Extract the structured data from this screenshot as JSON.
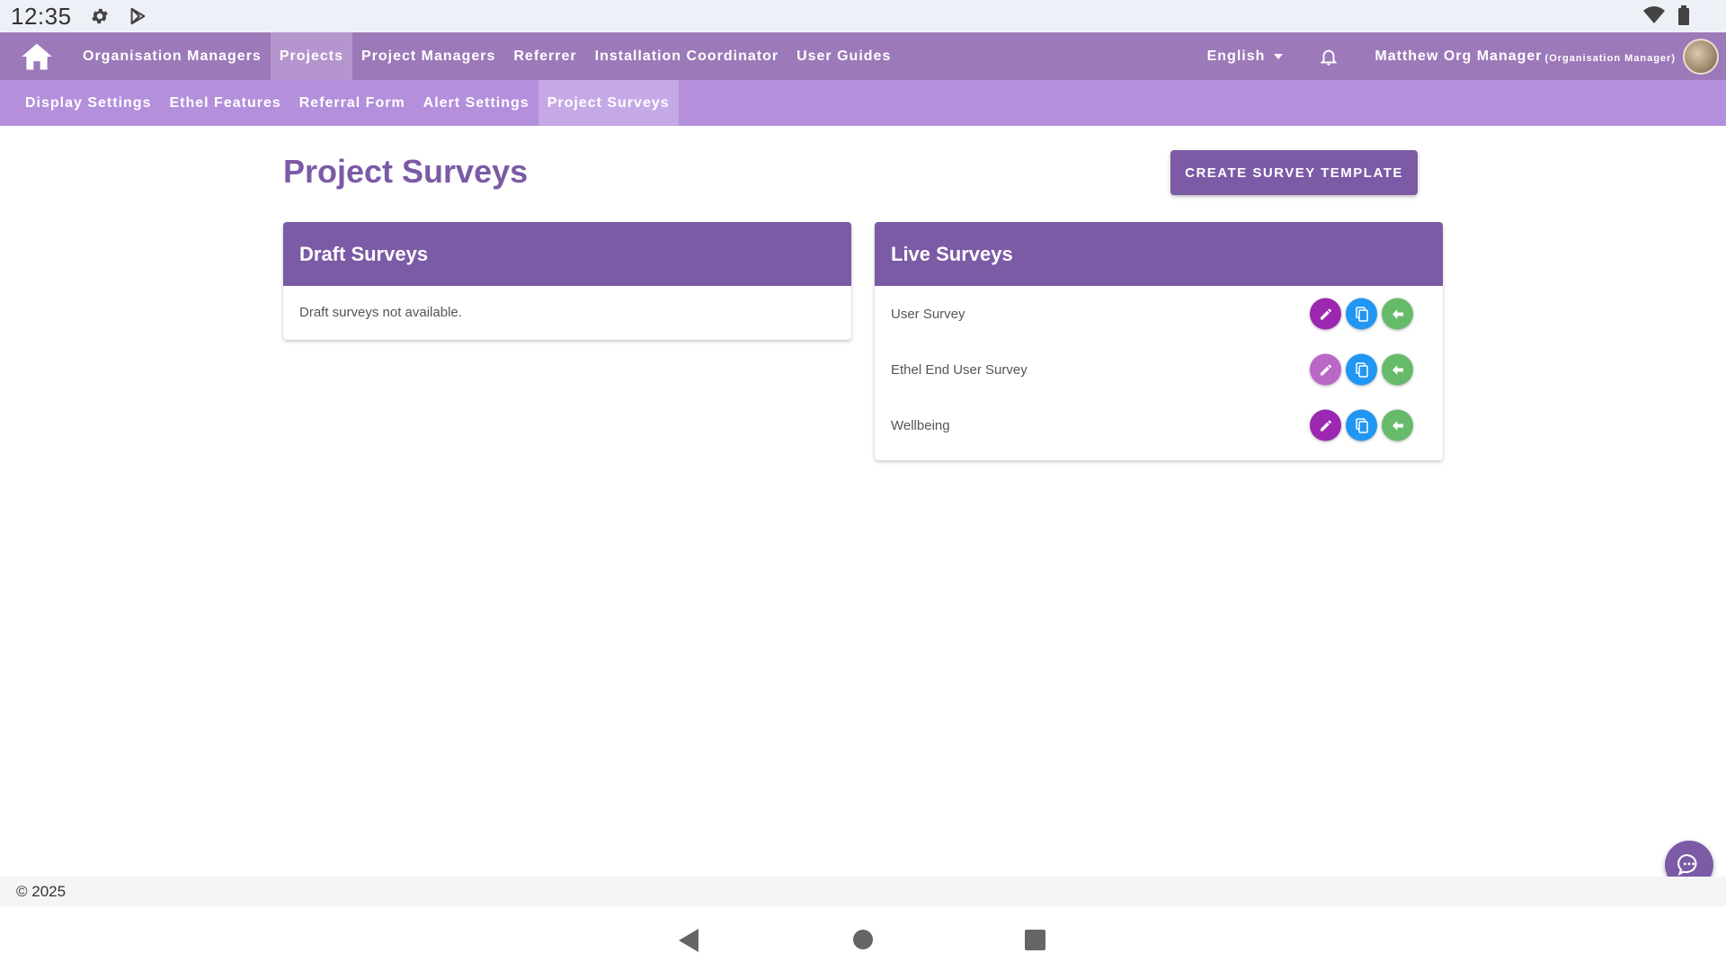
{
  "status_bar": {
    "time": "12:35",
    "icons": [
      "settings-gear-icon",
      "play-store-icon",
      "wifi-icon",
      "battery-icon"
    ]
  },
  "topnav": {
    "home_icon": "home-icon",
    "items": [
      {
        "label": "Organisation Managers",
        "active": false
      },
      {
        "label": "Projects",
        "active": true
      },
      {
        "label": "Project Managers",
        "active": false
      },
      {
        "label": "Referrer",
        "active": false
      },
      {
        "label": "Installation Coordinator",
        "active": false
      },
      {
        "label": "User Guides",
        "active": false
      }
    ],
    "language": "English",
    "bell_icon": "bell-icon",
    "user_name": "Matthew Org Manager",
    "user_role": "(Organisation Manager)"
  },
  "subnav": {
    "items": [
      {
        "label": "Display Settings",
        "active": false
      },
      {
        "label": "Ethel Features",
        "active": false
      },
      {
        "label": "Referral Form",
        "active": false
      },
      {
        "label": "Alert Settings",
        "active": false
      },
      {
        "label": "Project Surveys",
        "active": true
      }
    ]
  },
  "main": {
    "title": "Project Surveys",
    "create_button": "CREATE SURVEY TEMPLATE",
    "draft": {
      "header": "Draft Surveys",
      "empty_text": "Draft surveys not available."
    },
    "live": {
      "header": "Live Surveys",
      "surveys": [
        {
          "name": "User Survey"
        },
        {
          "name": "Ethel End User Survey"
        },
        {
          "name": "Wellbeing"
        }
      ]
    }
  },
  "colors": {
    "primary": "#7b5aa6",
    "nav": "#9c79b8",
    "subnav": "#b38fdc",
    "edit": "#9c27b0",
    "copy": "#2196f3",
    "move": "#66bb6a"
  },
  "footer": {
    "copyright": "© 2025"
  }
}
